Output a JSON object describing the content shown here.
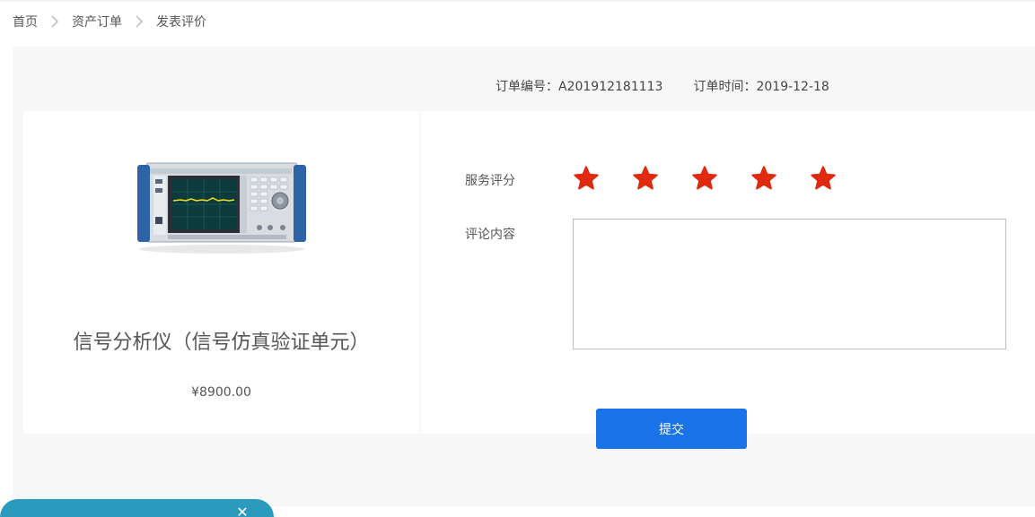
{
  "breadcrumb": {
    "items": [
      {
        "label": "首页"
      },
      {
        "label": "资产订单"
      },
      {
        "label": "发表评价"
      }
    ]
  },
  "order": {
    "number_text": "订单编号：A201912181113",
    "time_text": "订单时间：2019-12-18"
  },
  "product": {
    "name": "信号分析仪（信号仿真验证单元）",
    "price": "¥8900.00",
    "image_name": "signal-analyzer-image"
  },
  "review": {
    "rating_label": "服务评分",
    "rating": 5,
    "rating_max": 5,
    "comment_label": "评论内容",
    "comment_value": "",
    "star_color": "#e02a10"
  },
  "actions": {
    "submit_label": "提交"
  },
  "floating": {
    "close_icon": "close-icon"
  },
  "colors": {
    "accent": "#1a73e8",
    "panel_bg": "#f7f7f7",
    "floating_bar": "#2a9bbd"
  }
}
